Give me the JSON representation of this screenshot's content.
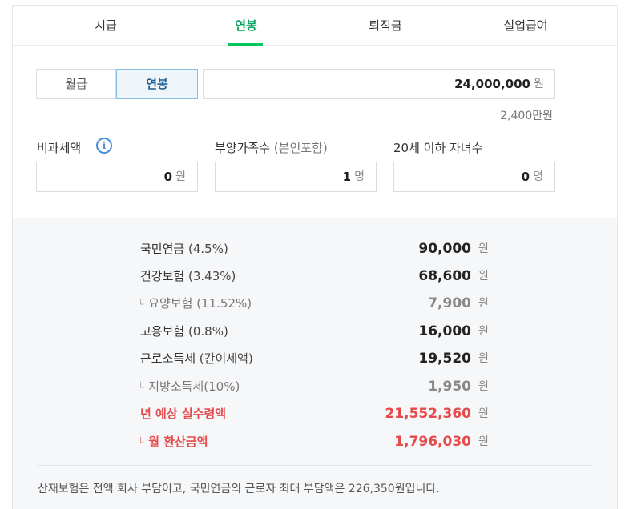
{
  "tabs": [
    {
      "label": "시급"
    },
    {
      "label": "연봉"
    },
    {
      "label": "퇴직금"
    },
    {
      "label": "실업급여"
    }
  ],
  "salary": {
    "toggle_monthly": "월급",
    "toggle_annual": "연봉",
    "value": "24,000,000",
    "unit": "원",
    "hint": "2,400만원"
  },
  "fields": {
    "tax_free": {
      "label": "비과세액",
      "value": "0",
      "unit": "원"
    },
    "dependents": {
      "label": "부양가족수",
      "label_sub": "(본인포함)",
      "value": "1",
      "unit": "명"
    },
    "children": {
      "label": "20세 이하 자녀수",
      "value": "0",
      "unit": "명"
    }
  },
  "results": {
    "unit": "원",
    "rows": [
      {
        "label": "국민연금",
        "rate": "(4.5%)",
        "value": "90,000"
      },
      {
        "label": "건강보험",
        "rate": "(3.43%)",
        "value": "68,600"
      },
      {
        "label": "요양보험",
        "rate": "(11.52%)",
        "value": "7,900",
        "branch": "└"
      },
      {
        "label": "고용보험",
        "rate": "(0.8%)",
        "value": "16,000"
      },
      {
        "label": "근로소득세",
        "rate": "(간이세액)",
        "value": "19,520"
      },
      {
        "label": "지방소득세",
        "rate": "(10%)",
        "value": "1,950",
        "branch": "└"
      },
      {
        "label": "년 예상 실수령액",
        "rate": "",
        "value": "21,552,360"
      },
      {
        "label": "월 환산금액",
        "rate": "",
        "value": "1,796,030",
        "branch": "└"
      }
    ],
    "footnote": "산재보험은 전액 회사 부담이고, 국민연금의 근로자 최대 부담액은 226,350원입니다."
  }
}
